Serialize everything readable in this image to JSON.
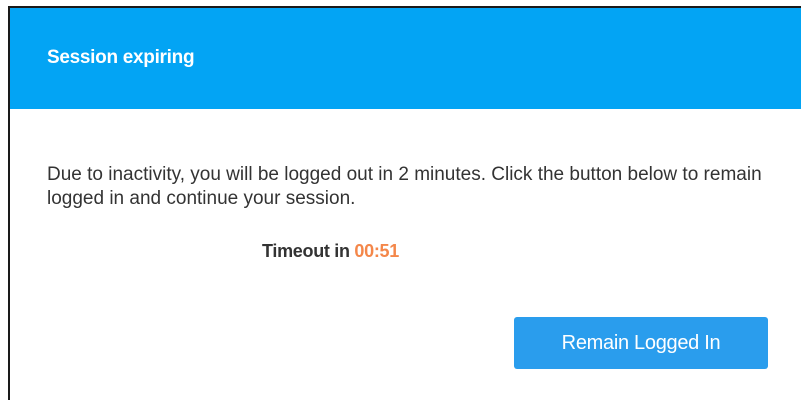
{
  "dialog": {
    "title": "Session expiring",
    "message": "Due to inactivity, you will be logged out in 2 minutes. Click the button below to remain logged in and continue your session.",
    "timeout_label": "Timeout in",
    "timeout_value": "00:51",
    "button_label": "Remain Logged In"
  },
  "colors": {
    "header_bg": "#03a4f4",
    "button_bg": "#2a9ded",
    "timer_accent": "#f4874a",
    "body_text": "#333333"
  }
}
